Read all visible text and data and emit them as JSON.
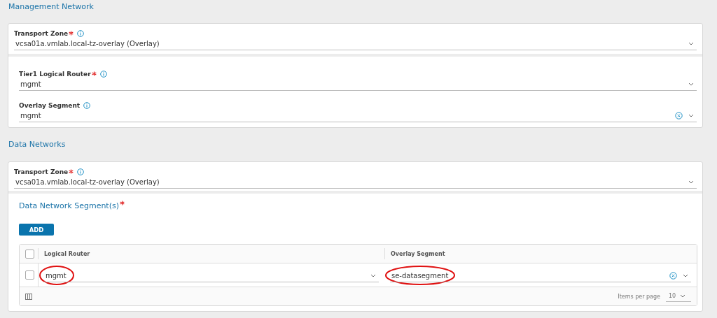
{
  "management_network": {
    "heading": "Management Network",
    "transport_zone": {
      "label": "Transport Zone",
      "required": true,
      "info": true,
      "value": "vcsa01a.vmlab.local-tz-overlay (Overlay)",
      "clearable": false
    },
    "fields": [
      {
        "label": "Tier1 Logical Router",
        "required": true,
        "info": true,
        "value": "mgmt",
        "clearable": false
      },
      {
        "label": "Overlay Segment",
        "required": false,
        "info": true,
        "value": "mgmt",
        "clearable": true
      }
    ]
  },
  "data_networks": {
    "heading": "Data Networks",
    "transport_zone": {
      "label": "Transport Zone",
      "required": true,
      "info": true,
      "value": "vcsa01a.vmlab.local-tz-overlay (Overlay)",
      "clearable": false
    },
    "segments_title": "Data Network Segment(s)",
    "segments_required": true,
    "add_button": "ADD",
    "table": {
      "all_checked": false,
      "columns": [
        "Logical Router",
        "Overlay Segment"
      ],
      "rows": [
        {
          "checked": false,
          "cells": [
            {
              "value": "mgmt",
              "clearable": false,
              "circled": true
            },
            {
              "value": "se-datasegment",
              "clearable": true,
              "circled": true
            }
          ]
        }
      ],
      "items_per_page_label": "Items per page",
      "items_per_page": "10"
    }
  }
}
